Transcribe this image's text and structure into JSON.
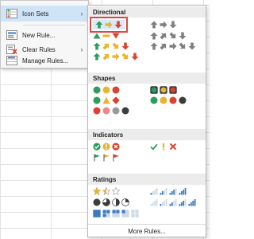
{
  "menu": {
    "items": [
      {
        "label": "Icon Sets",
        "has_submenu": true,
        "active": true,
        "icon": "icon-sets-icon"
      },
      {
        "label": "New Rule...",
        "has_submenu": false,
        "icon": "new-rule-icon"
      },
      {
        "label": "Clear Rules",
        "has_submenu": true,
        "icon": "clear-rules-icon"
      },
      {
        "label": "Manage Rules...",
        "has_submenu": false,
        "icon": "manage-rules-icon"
      }
    ]
  },
  "gallery": {
    "sections": [
      {
        "title": "Directional"
      },
      {
        "title": "Shapes"
      },
      {
        "title": "Indicators"
      },
      {
        "title": "Ratings"
      }
    ],
    "more_rules": "More Rules...",
    "highlighted_set": "3 Arrows (Colored)"
  },
  "colors": {
    "green": "#2e9b5f",
    "yellow": "#e8b532",
    "red": "#d9442f",
    "gray": "#7f7f7f",
    "black": "#3c3c3c",
    "blue": "#3b79c0",
    "highlight": "#e04545"
  }
}
